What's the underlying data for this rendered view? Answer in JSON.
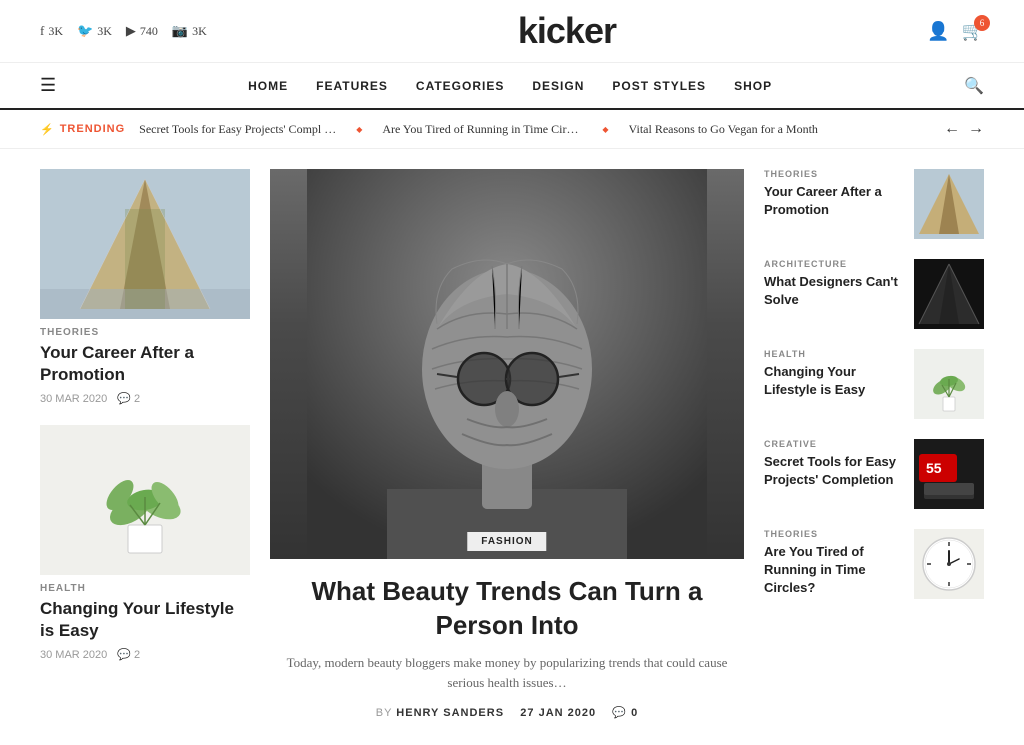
{
  "site": {
    "title": "kicker"
  },
  "social": [
    {
      "icon": "f",
      "label": "3K",
      "name": "facebook"
    },
    {
      "icon": "🐦",
      "label": "3K",
      "name": "twitter"
    },
    {
      "icon": "▶",
      "label": "740",
      "name": "youtube"
    },
    {
      "icon": "📷",
      "label": "3K",
      "name": "instagram"
    }
  ],
  "cart": {
    "badge": "6"
  },
  "nav": {
    "menu_items": [
      "HOME",
      "FEATURES",
      "CATEGORIES",
      "DESIGN",
      "POST STYLES",
      "SHOP"
    ]
  },
  "trending": {
    "label": "TRENDING",
    "items": [
      "Secret Tools for Easy Projects' Compl …",
      "Are You Tired of Running in Time Circl…",
      "Vital Reasons to Go Vegan for a Month"
    ]
  },
  "left_cards": [
    {
      "category": "THEORIES",
      "title": "Your Career After a Promotion",
      "date": "30 MAR 2020",
      "comments": "2",
      "image_type": "arch"
    },
    {
      "category": "HEALTH",
      "title": "Changing Your Lifestyle is Easy",
      "date": "30 MAR 2020",
      "comments": "2",
      "image_type": "plant"
    }
  ],
  "featured": {
    "tag": "FASHION",
    "title": "What Beauty Trends Can Turn a Person Into",
    "excerpt": "Today, modern beauty bloggers make money by popularizing trends that could cause serious health issues…",
    "author": "HENRY SANDERS",
    "date": "27 JAN 2020",
    "comments": "0"
  },
  "right_items": [
    {
      "category": "THEORIES",
      "title": "Your Career After a Promotion",
      "thumb_type": "arch"
    },
    {
      "category": "ARCHITECTURE",
      "title": "What Designers Can't Solve",
      "thumb_type": "dark"
    },
    {
      "category": "HEALTH",
      "title": "Changing Your Lifestyle is Easy",
      "thumb_type": "plant"
    },
    {
      "category": "CREATIVE",
      "title": "Secret Tools for Easy Projects' Completion",
      "thumb_type": "red"
    },
    {
      "category": "THEORIES",
      "title": "Are You Tired of Running in Time Circles?",
      "thumb_type": "clock"
    }
  ]
}
